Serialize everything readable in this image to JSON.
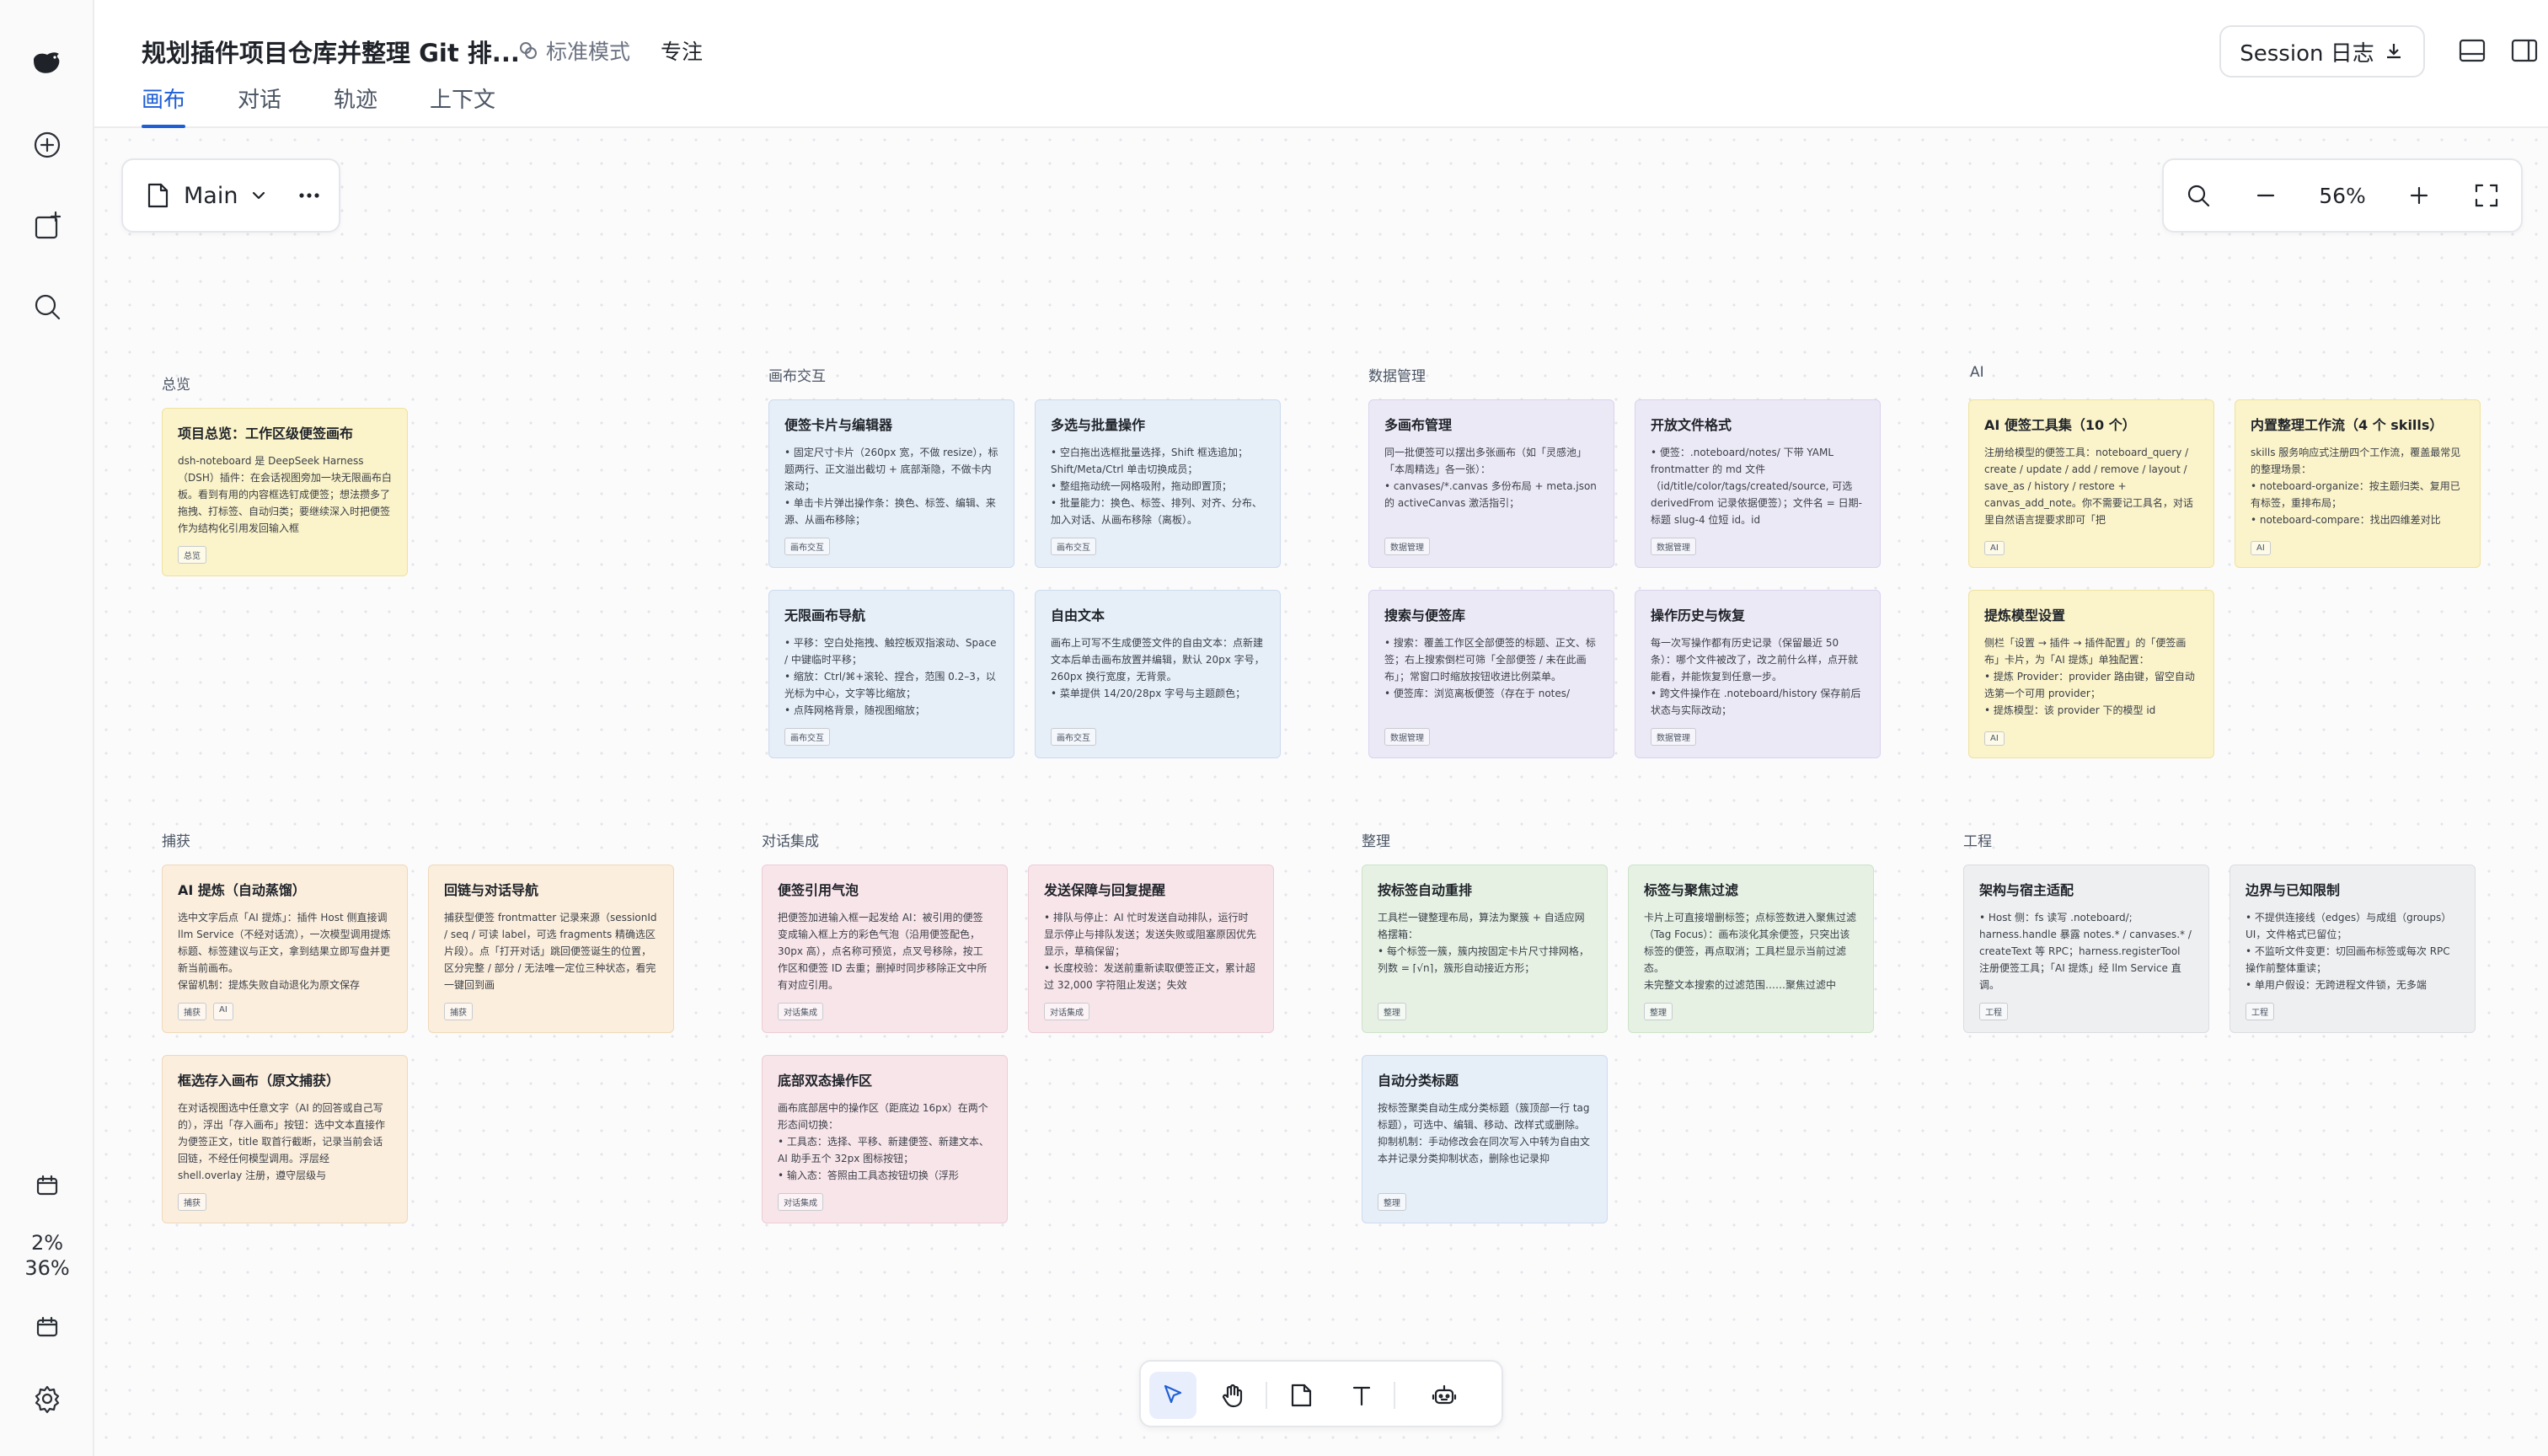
{
  "header": {
    "title": "规划插件项目仓库并整理 Git 排...",
    "mode_label": "标准模式",
    "focus_label": "专注",
    "session_label": "Session 日志",
    "tabs": [
      {
        "label": "画布",
        "active": true
      },
      {
        "label": "对话",
        "active": false
      },
      {
        "label": "轨迹",
        "active": false
      },
      {
        "label": "上下文",
        "active": false
      }
    ]
  },
  "sidebar": {
    "usage_line1": "2%",
    "usage_line2": "36%"
  },
  "canvas": {
    "board_name": "Main",
    "zoom_label": "56%"
  },
  "sections": {
    "overview": "总览",
    "canvas_interaction": "画布交互",
    "data_management": "数据管理",
    "ai": "AI",
    "capture": "捕获",
    "chat_integration": "对话集成",
    "organize": "整理",
    "engineering": "工程"
  },
  "cards": [
    {
      "title": "项目总览：工作区级便签画布",
      "body": "dsh-noteboard 是 DeepSeek Harness（DSH）插件：在会话视图旁加一块无限画布白板。看到有用的内容框选钉成便签；想法攒多了拖拽、打标签、自动归类；要继续深入时把便签作为结构化引用发回输入框",
      "tags": [
        "总览"
      ],
      "color": "yellow"
    },
    {
      "title": "便签卡片与编辑器",
      "body": "• 固定尺寸卡片（260px 宽，不做 resize），标题两行、正文溢出截切 + 底部渐隐，不做卡内滚动；\n• 单击卡片弹出操作条：换色、标签、编辑、来源、从画布移除；",
      "tags": [
        "画布交互"
      ],
      "color": "blue"
    },
    {
      "title": "多选与批量操作",
      "body": "• 空白拖出选框批量选择，Shift 框选追加；Shift/Meta/Ctrl 单击切换成员；\n• 整组拖动统一网格吸附，拖动即置顶；\n• 批量能力：换色、标签、排列、对齐、分布、加入对话、从画布移除（离板）。",
      "tags": [
        "画布交互"
      ],
      "color": "blue"
    },
    {
      "title": "无限画布导航",
      "body": "• 平移：空白处拖拽、触控板双指滚动、Space / 中键临时平移；\n• 缩放：Ctrl/⌘+滚轮、捏合，范围 0.2–3，以光标为中心，文字等比缩放；\n• 点阵网格背景，随视图缩放；",
      "tags": [
        "画布交互"
      ],
      "color": "blue"
    },
    {
      "title": "自由文本",
      "body": "画布上可写不生成便签文件的自由文本：点新建文本后单击画布放置并编辑，默认 20px 字号，260px 换行宽度，无背景。\n• 菜单提供 14/20/28px 字号与主题颜色；",
      "tags": [
        "画布交互"
      ],
      "color": "blue"
    },
    {
      "title": "多画布管理",
      "body": "同一批便签可以摆出多张画布（如「灵感池」「本周精选」各一张）：\n• canvases/*.canvas 多份布局 + meta.json 的 activeCanvas 激活指引；",
      "tags": [
        "数据管理"
      ],
      "color": "purple"
    },
    {
      "title": "开放文件格式",
      "body": "• 便签：.noteboard/notes/ 下带 YAML frontmatter 的 md 文件（id/title/color/tags/created/source, 可选 derivedFrom 记录依据便签）；文件名 = 日期-标题 slug-4 位短 id。id",
      "tags": [
        "数据管理"
      ],
      "color": "purple"
    },
    {
      "title": "搜索与便签库",
      "body": "• 搜索：覆盖工作区全部便签的标题、正文、标签；右上搜索倒栏可筛「全部便签 / 未在此画布」；常窗口时缩放按钮收进比例菜单。\n• 便签库：浏览离板便签（存在于 notes/",
      "tags": [
        "数据管理"
      ],
      "color": "purple"
    },
    {
      "title": "操作历史与恢复",
      "body": "每一次写操作都有历史记录（保留最近 50 条）：哪个文件被改了，改之前什么样，点开就能看，并能恢复到任意一步。\n• 跨文件操作在 .noteboard/history 保存前后状态与实际改动；",
      "tags": [
        "数据管理"
      ],
      "color": "purple"
    },
    {
      "title": "AI 便签工具集（10 个）",
      "body": "注册给模型的便签工具：noteboard_query / create / update / add / remove / layout / save_as / history / restore + canvas_add_note。你不需要记工具名，对话里自然语言提要求即可「把",
      "tags": [
        "AI"
      ],
      "color": "yellow"
    },
    {
      "title": "内置整理工作流（4 个 skills）",
      "body": "skills 服务响应式注册四个工作流，覆盖最常见的整理场景：\n• noteboard-organize：按主题归类、复用已有标签，重排布局；\n• noteboard-compare：找出四维差对比",
      "tags": [
        "AI"
      ],
      "color": "yellow"
    },
    {
      "title": "提炼模型设置",
      "body": "侧栏「设置 → 插件 → 插件配置」的「便签画布」卡片，为「AI 提炼」单独配置：\n• 提炼 Provider：provider 路由键，留空自动选第一个可用 provider；\n• 提炼模型：该 provider 下的模型 id",
      "tags": [
        "AI"
      ],
      "color": "yellow"
    },
    {
      "title": "AI 提炼（自动蒸馏）",
      "body": "选中文字后点「AI 提炼」：插件 Host 侧直接调 llm Service（不经对话流），一次模型调用提炼标题、标签建议与正文，拿到结果立即写盘并更新当前画布。\n保留机制：提炼失败自动退化为原文保存",
      "tags": [
        "捕获",
        "AI"
      ],
      "color": "orange"
    },
    {
      "title": "回链与对话导航",
      "body": "捕获型便签 frontmatter 记录来源（sessionId / seq / 可读 label，可选 fragments 精确选区片段）。点「打开对话」跳回便签诞生的位置，区分完整 / 部分 / 无法唯一定位三种状态，看完一键回到画",
      "tags": [
        "捕获"
      ],
      "color": "orange"
    },
    {
      "title": "框选存入画布（原文捕获）",
      "body": "在对话视图选中任意文字（AI 的回答或自己写的），浮出「存入画布」按钮：选中文本直接作为便签正文，title 取首行截断，记录当前会话回链，不经任何模型调用。浮层经 shell.overlay 注册，遵守层级与",
      "tags": [
        "捕获"
      ],
      "color": "orange"
    },
    {
      "title": "便签引用气泡",
      "body": "把便签加进输入框一起发给 AI：被引用的便签变成输入框上方的彩色气泡（沿用便签配色，30px 高），点名称可预览，点叉号移除，按工作区和便签 ID 去重；删掉时同步移除正文中所有对应引用。",
      "tags": [
        "对话集成"
      ],
      "color": "pink"
    },
    {
      "title": "发送保障与回复提醒",
      "body": "• 排队与停止：AI 忙时发送自动排队，运行时显示停止与排队发送；发送失败或阻塞原因优先显示，草稿保留；\n• 长度校验：发送前重新读取便签正文，累计超过 32,000 字符阻止发送；失效",
      "tags": [
        "对话集成"
      ],
      "color": "pink"
    },
    {
      "title": "底部双态操作区",
      "body": "画布底部居中的操作区（距底边 16px）在两个形态间切换：\n• 工具态：选择、平移、新建便签、新建文本、AI 助手五个 32px 图标按钮；\n• 输入态：答照由工具态按钮切换（浮形",
      "tags": [
        "对话集成"
      ],
      "color": "pink"
    },
    {
      "title": "按标签自动重排",
      "body": "工具栏一键整理布局，算法为聚簇 + 自适应网格摆箱：\n• 每个标签一簇，簇内按固定卡片尺寸排网格，列数 = ⌈√n⌉，簇形自动接近方形；",
      "tags": [
        "整理"
      ],
      "color": "green"
    },
    {
      "title": "标签与聚焦过滤",
      "body": "卡片上可直接增删标签；点标签数进入聚焦过滤（Tag Focus）：画布淡化其余便签，只突出该标签的便签，再点取消；工具栏显示当前过滤态。\n未完整文本搜索的过滤范围……聚焦过滤中",
      "tags": [
        "整理"
      ],
      "color": "green"
    },
    {
      "title": "自动分类标题",
      "body": "按标签聚类自动生成分类标题（簇顶部一行 tag 标题），可选中、编辑、移动、改样式或删除。\n抑制机制：手动修改会在同次写入中转为自由文本并记录分类抑制状态，删除也记录抑",
      "tags": [
        "整理"
      ],
      "color": "blue"
    },
    {
      "title": "架构与宿主适配",
      "body": "• Host 侧：fs 读写 .noteboard/; harness.handle 暴露 notes.* / canvases.* / createText 等 RPC；harness.registerTool 注册便签工具；「AI 提炼」经 llm Service 直调。",
      "tags": [
        "工程"
      ],
      "color": "gray"
    },
    {
      "title": "边界与已知限制",
      "body": "• 不提供连接线（edges）与成组（groups）UI，文件格式已留位；\n• 不监听文件变更：切回画布标签或每次 RPC 操作前整体重读；\n• 单用户假设：无跨进程文件锁，无多端",
      "tags": [
        "工程"
      ],
      "color": "gray"
    }
  ]
}
